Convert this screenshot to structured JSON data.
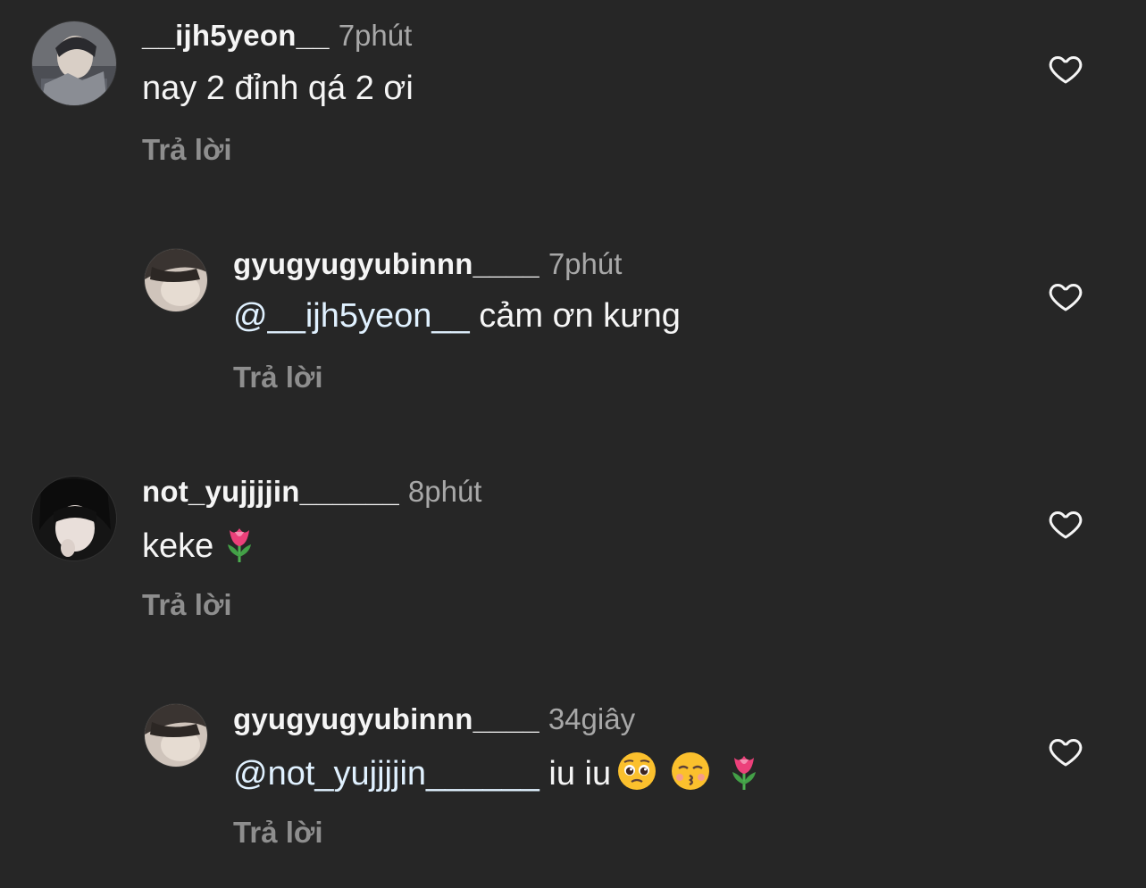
{
  "colors": {
    "background": "#262626",
    "username": "#f5f5f5",
    "timestamp": "#a8a8a8",
    "reply": "#8e8e8e",
    "mention": "#e0f1ff"
  },
  "comments": [
    {
      "username": "__ijh5yeon__",
      "time": "7phút",
      "text": "nay 2 đỉnh qá 2 ơi",
      "reply_label": "Trả lời",
      "like_icon": "heart-outline-icon"
    },
    {
      "username": "gyugyugyubinnn____",
      "time": "7phút",
      "mention": "@__ijh5yeon__",
      "text": " cảm ơn kưng",
      "reply_label": "Trả lời",
      "like_icon": "heart-outline-icon"
    },
    {
      "username": "not_yujjjjin______",
      "time": "8phút",
      "text": "keke",
      "emojis": [
        "tulip-emoji"
      ],
      "reply_label": "Trả lời",
      "like_icon": "heart-outline-icon"
    },
    {
      "username": "gyugyugyubinnn____",
      "time": "34giây",
      "mention": "@not_yujjjjin______",
      "text": " iu iu",
      "emojis": [
        "pleading-face-emoji",
        "kissing-face-emoji",
        "tulip-emoji"
      ],
      "reply_label": "Trả lời",
      "like_icon": "heart-outline-icon"
    }
  ]
}
